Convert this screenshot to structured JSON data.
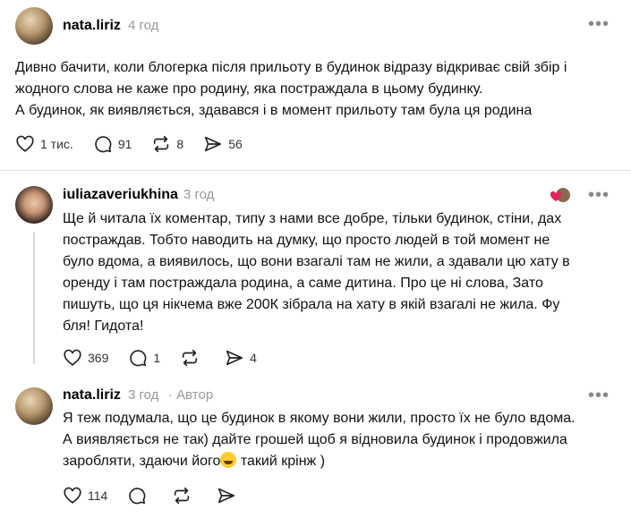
{
  "posts": [
    {
      "username": "nata.liriz",
      "time": "4 год",
      "author_tag": "",
      "text_lines": [
        "Дивно бачити, коли блогерка після прильоту в будинок відразу відкриває свій збір і",
        "жодного слова не каже про родину, яка постраждала в цьому будинку.",
        "А будинок, як виявляється, здавався і в момент прильоту там була ця родина"
      ],
      "likes": "1 тис.",
      "replies": "91",
      "reposts": "8",
      "shares": "56"
    },
    {
      "username": "iuliazaveriukhina",
      "time": "3 год",
      "author_tag": "",
      "text_lines": [
        "Ще й читала їх коментар, типу з нами все добре, тільки будинок, стіни, дах",
        "постраждав. Тобто наводить на думку, що просто людей в той момент не",
        "було вдома, а виявилось, що вони взагалі там не жили, а здавали цю хату в",
        "оренду і там постраждала родина, а саме дитина. Про це ні слова, Зато",
        "пишуть, що ця нікчема вже 200К зібрала на хату в якій взагалі не жила. Фу",
        "бля! Гидота!"
      ],
      "likes": "369",
      "replies": "1",
      "reposts": "",
      "shares": "4"
    },
    {
      "username": "nata.liriz",
      "time": "3 год",
      "author_tag": "· Автор",
      "text_lines": [
        "Я теж подумала, що це будинок в якому вони жили, просто їх не було вдома.",
        "А виявляється не так) дайте грошей щоб я відновила будинок і продовжила"
      ],
      "text_line3_before": "заробляти, здаючи його",
      "text_line3_after": " такий крінж )",
      "emoji": "grinning-sweat-emoji",
      "likes": "114",
      "replies": "",
      "reposts": "",
      "shares": ""
    }
  ],
  "colors": {
    "text": "#111111",
    "muted": "#999999",
    "like_heart": "#e0245e",
    "divider": "#e0e0e0"
  },
  "icons": [
    "heart-icon",
    "comment-icon",
    "repost-icon",
    "share-icon",
    "more-icon"
  ]
}
